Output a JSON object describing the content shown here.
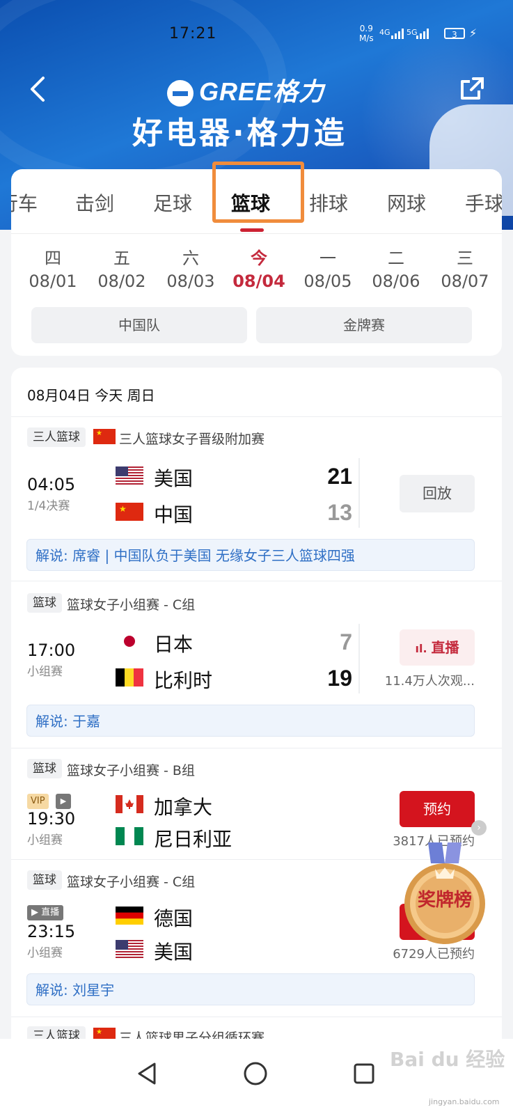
{
  "status_bar": {
    "time": "17:21",
    "net_speed": "0.9",
    "net_unit": "M/s",
    "sig1": "4G",
    "sig2": "5G",
    "battery": "3"
  },
  "header": {
    "brand": "GREE格力",
    "slogan": "好电器·格力造"
  },
  "tabs": [
    {
      "label": "行车",
      "active": false
    },
    {
      "label": "击剑",
      "active": false
    },
    {
      "label": "足球",
      "active": false
    },
    {
      "label": "篮球",
      "active": true
    },
    {
      "label": "排球",
      "active": false
    },
    {
      "label": "网球",
      "active": false
    },
    {
      "label": "手球",
      "active": false
    }
  ],
  "dates": [
    {
      "weekday": "四",
      "date": "08/01",
      "active": false
    },
    {
      "weekday": "五",
      "date": "08/02",
      "active": false
    },
    {
      "weekday": "六",
      "date": "08/03",
      "active": false
    },
    {
      "weekday": "今",
      "date": "08/04",
      "active": true
    },
    {
      "weekday": "一",
      "date": "08/05",
      "active": false
    },
    {
      "weekday": "二",
      "date": "08/06",
      "active": false
    },
    {
      "weekday": "三",
      "date": "08/07",
      "active": false
    }
  ],
  "filters": [
    "中国队",
    "金牌赛"
  ],
  "day_header": "08月04日 今天 周日",
  "matches": [
    {
      "tag": "三人篮球",
      "title": "三人篮球女子晋级附加赛",
      "time": "04:05",
      "phase": "1/4决赛",
      "team1": "美国",
      "team2": "中国",
      "score1": "21",
      "score2": "13",
      "action": "回放",
      "commentary": "解说: 席睿 | 中国队负于美国 无缘女子三人篮球四强"
    },
    {
      "tag": "篮球",
      "title": "篮球女子小组赛 - C组",
      "time": "17:00",
      "phase": "小组赛",
      "team1": "日本",
      "team2": "比利时",
      "score1": "7",
      "score2": "19",
      "action": "直播",
      "sub": "11.4万人次观...",
      "commentary": "解说: 于嘉"
    },
    {
      "tag": "篮球",
      "title": "篮球女子小组赛 - B组",
      "badge": "VIP",
      "time": "19:30",
      "phase": "小组赛",
      "team1": "加拿大",
      "team2": "尼日利亚",
      "action": "预约",
      "sub": "3817人已预约"
    },
    {
      "tag": "篮球",
      "title": "篮球女子小组赛 - C组",
      "badge": "直播",
      "time": "23:15",
      "phase": "小组赛",
      "team1": "德国",
      "team2": "美国",
      "sub": "6729人已预约",
      "commentary": "解说: 刘星宇"
    },
    {
      "tag": "三人篮球",
      "title": "三人篮球男子分组循环赛"
    }
  ],
  "medal_label": "奖牌榜",
  "watermark": "Bai du 经验",
  "watermark_url": "jingyan.baidu.com"
}
